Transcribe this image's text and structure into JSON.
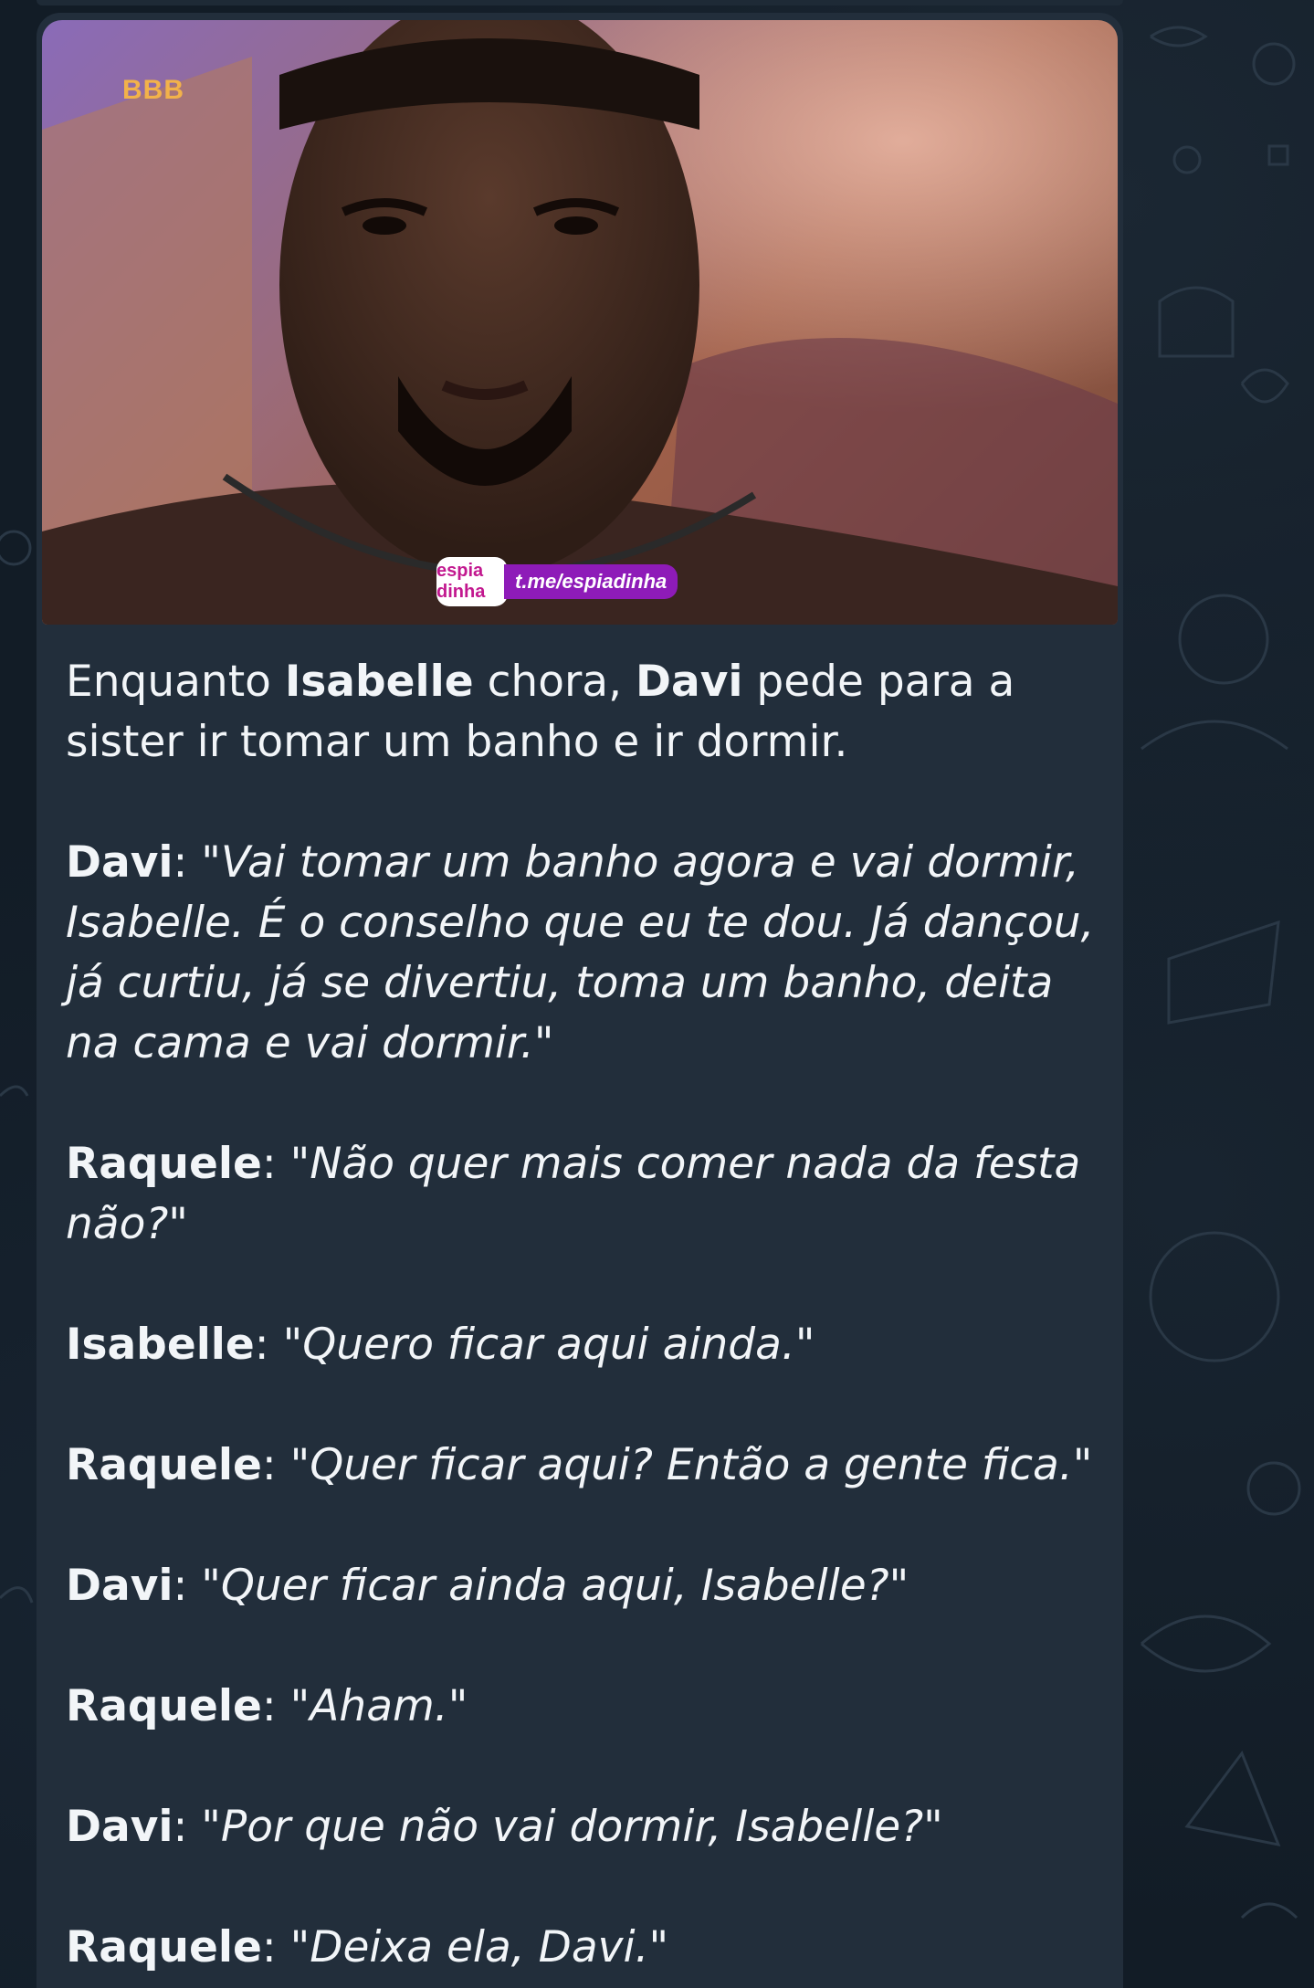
{
  "photo": {
    "channel_logo": "BBB",
    "watermark_badge": "espia dinha",
    "watermark_link": "t.me/espiadinha"
  },
  "message": {
    "intro": {
      "p1": "Enquanto ",
      "name1": "Isabelle",
      "p2": " chora, ",
      "name2": "Davi",
      "p3": " pede para a sister ir tomar um banho e ir dormir."
    },
    "lines": [
      {
        "speaker": "Davi",
        "sep": ": ",
        "quote": "\"Vai tomar um banho agora e vai dormir, Isabelle. É o conselho que eu te dou. Já dançou, já curtiu, já se divertiu, toma um banho, deita na cama e vai dormir.\""
      },
      {
        "speaker": "Raquele",
        "sep": ": ",
        "quote": "\"Não quer mais comer nada da festa não?\""
      },
      {
        "speaker": "Isabelle",
        "sep": ": ",
        "quote": "\"Quero ficar aqui ainda.\""
      },
      {
        "speaker": "Raquele",
        "sep": ": ",
        "quote": "\"Quer ficar aqui? Então a gente fica.\""
      },
      {
        "speaker": "Davi",
        "sep": ": ",
        "quote": "\"Quer ficar ainda aqui, Isabelle?\""
      },
      {
        "speaker": "Raquele",
        "sep": ": ",
        "quote": "\"Aham.\""
      },
      {
        "speaker": "Davi",
        "sep": ": ",
        "quote": "\"Por que não vai dormir, Isabelle?\""
      },
      {
        "speaker": "Raquele",
        "sep": ": ",
        "quote": "\"Deixa ela, Davi.\""
      }
    ]
  },
  "colors": {
    "chat_background": "#121c26",
    "bubble": "#222e3b",
    "text": "#f2f5f8",
    "watermark_purple": "#8e1bb8",
    "watermark_pink": "#c2188f",
    "logo_orange": "#f2b24a"
  }
}
